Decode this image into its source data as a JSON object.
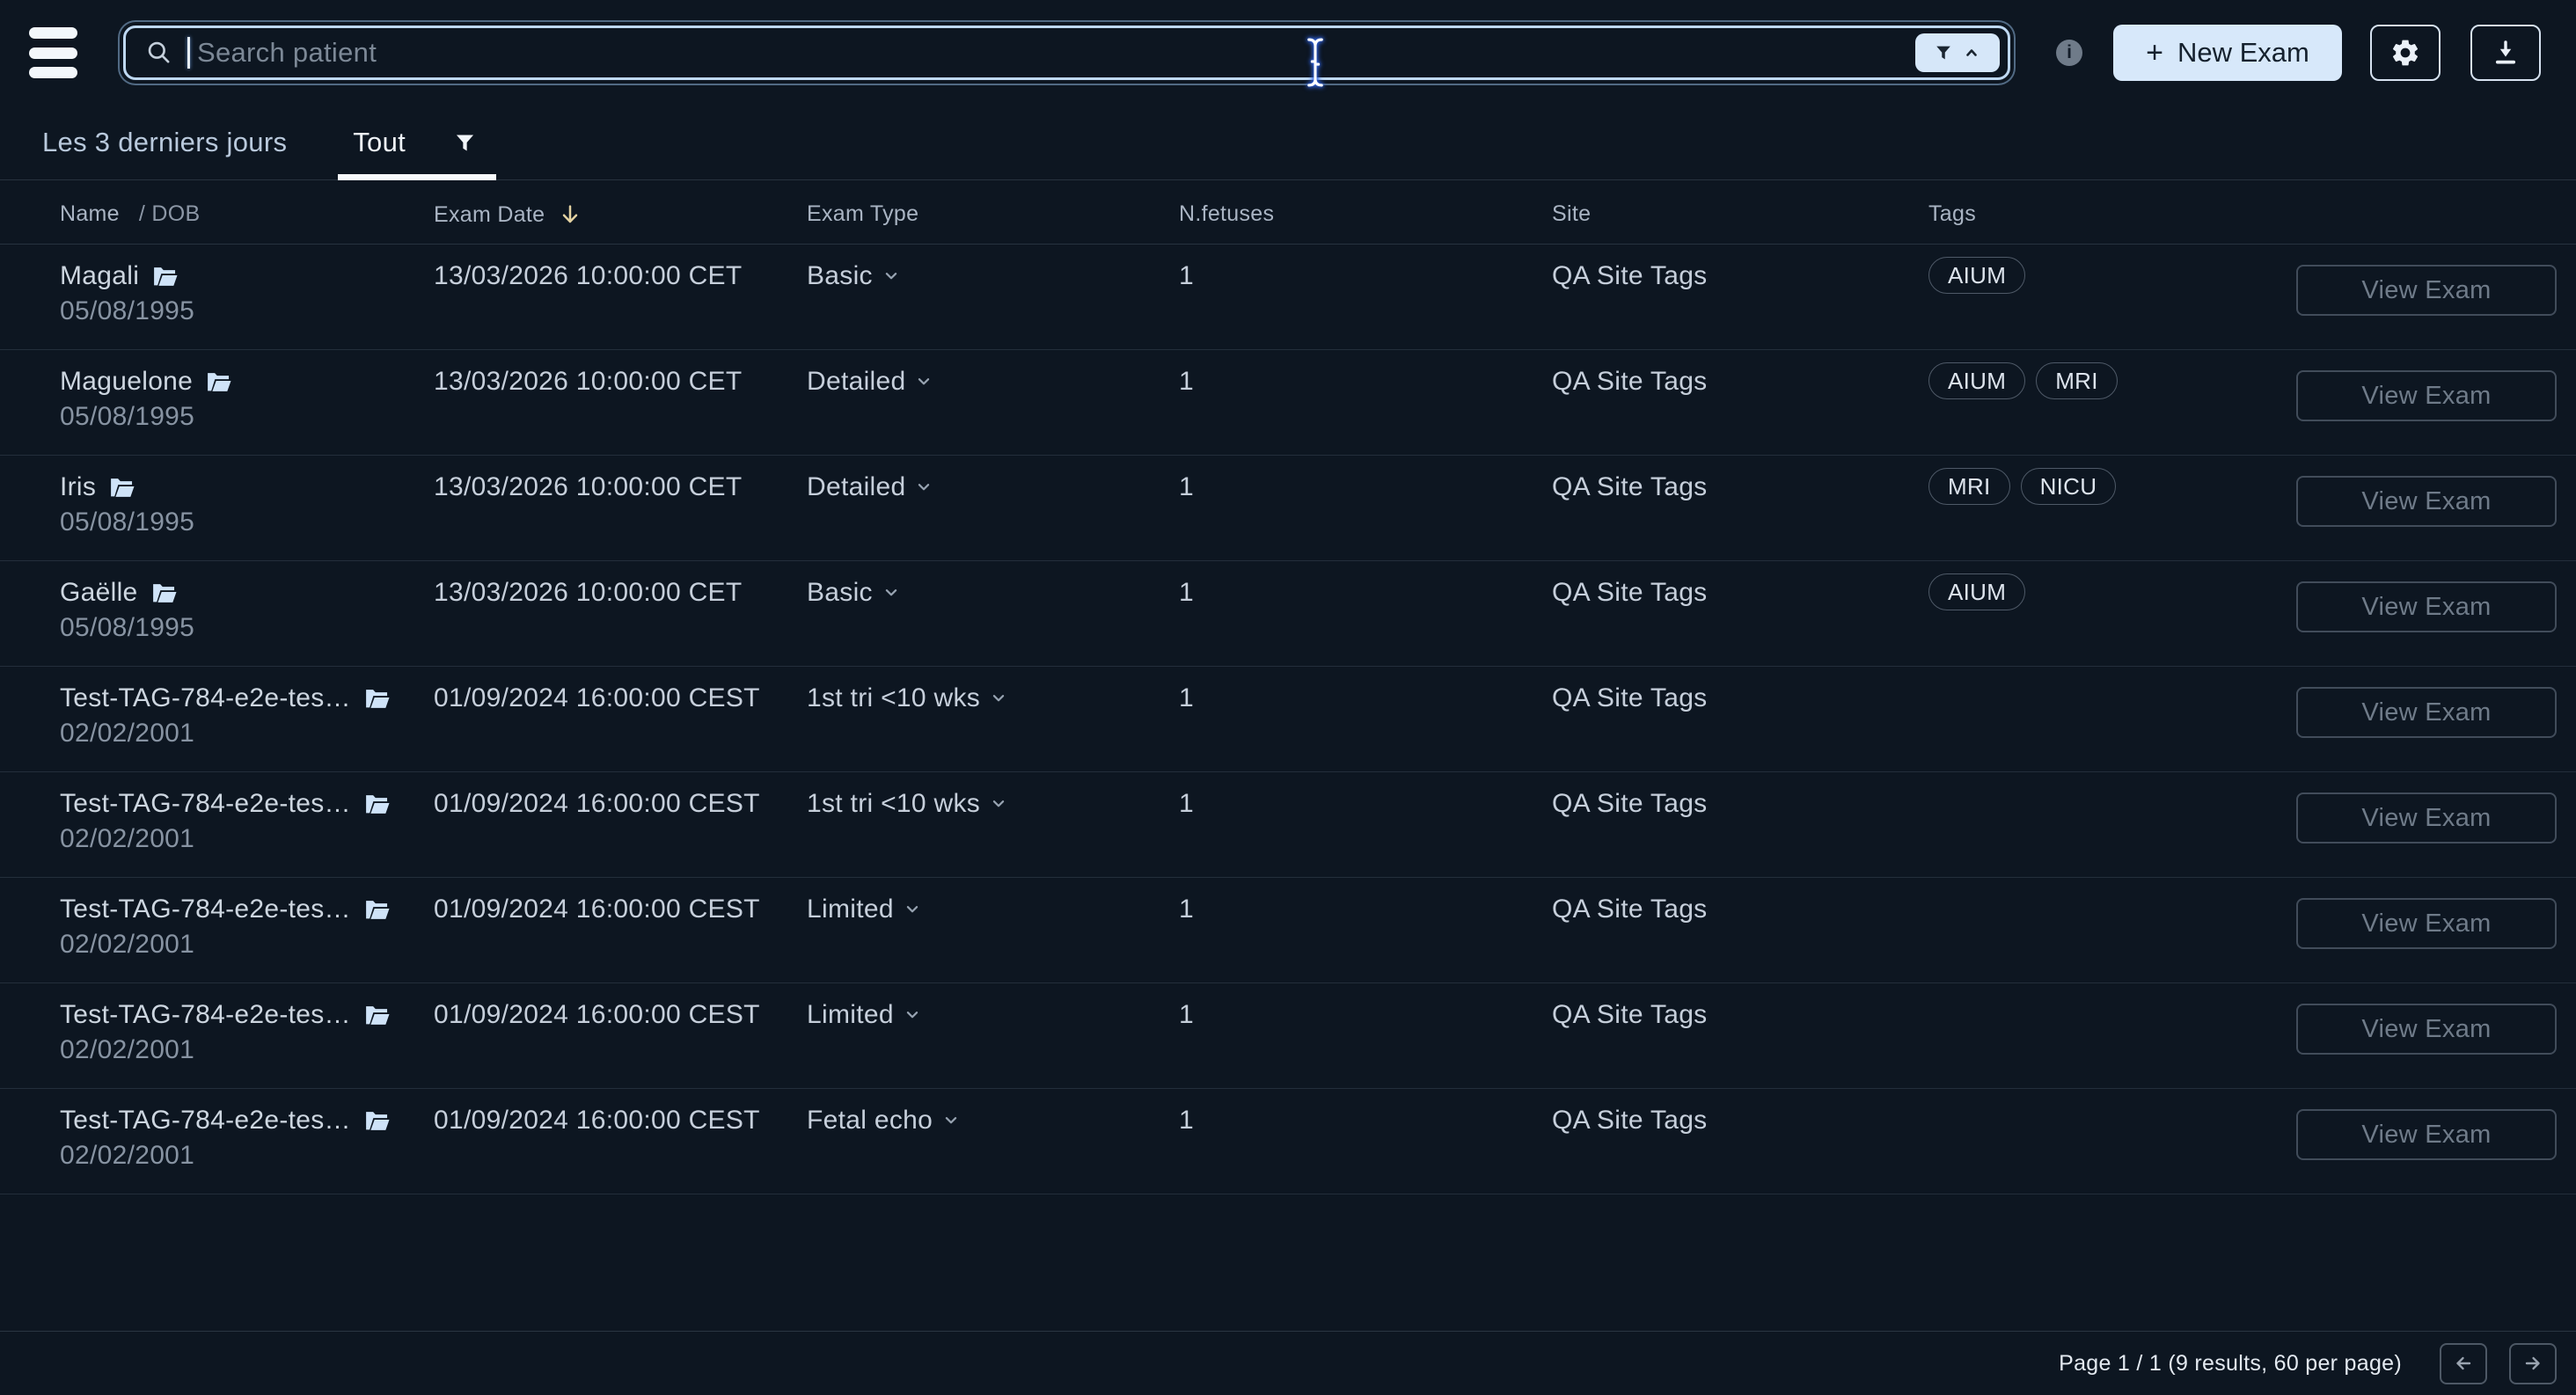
{
  "topbar": {
    "search_placeholder": "Search patient",
    "new_exam": {
      "plus": "+",
      "label": "New Exam"
    }
  },
  "filters": {
    "date_range_label": "Les 3 derniers jours",
    "active_tab": "Tout"
  },
  "table": {
    "headers": {
      "name": "Name",
      "dob": "/ DOB",
      "exam_date": "Exam Date",
      "exam_type": "Exam Type",
      "n_fetuses": "N.fetuses",
      "site": "Site",
      "tags": "Tags"
    },
    "view_exam_label": "View Exam",
    "rows": [
      {
        "name": "Magali",
        "dob": "05/08/1995",
        "exam_date": "13/03/2026 10:00:00 CET",
        "exam_type": "Basic",
        "n_fetuses": "1",
        "site": "QA Site Tags",
        "tags": [
          "AIUM"
        ]
      },
      {
        "name": "Maguelone",
        "dob": "05/08/1995",
        "exam_date": "13/03/2026 10:00:00 CET",
        "exam_type": "Detailed",
        "n_fetuses": "1",
        "site": "QA Site Tags",
        "tags": [
          "AIUM",
          "MRI"
        ]
      },
      {
        "name": "Iris",
        "dob": "05/08/1995",
        "exam_date": "13/03/2026 10:00:00 CET",
        "exam_type": "Detailed",
        "n_fetuses": "1",
        "site": "QA Site Tags",
        "tags": [
          "MRI",
          "NICU"
        ]
      },
      {
        "name": "Gaëlle",
        "dob": "05/08/1995",
        "exam_date": "13/03/2026 10:00:00 CET",
        "exam_type": "Basic",
        "n_fetuses": "1",
        "site": "QA Site Tags",
        "tags": [
          "AIUM"
        ]
      },
      {
        "name": "Test-TAG-784-e2e-tes…",
        "dob": "02/02/2001",
        "exam_date": "01/09/2024 16:00:00 CEST",
        "exam_type": "1st tri <10 wks",
        "n_fetuses": "1",
        "site": "QA Site Tags",
        "tags": []
      },
      {
        "name": "Test-TAG-784-e2e-tes…",
        "dob": "02/02/2001",
        "exam_date": "01/09/2024 16:00:00 CEST",
        "exam_type": "1st tri <10 wks",
        "n_fetuses": "1",
        "site": "QA Site Tags",
        "tags": []
      },
      {
        "name": "Test-TAG-784-e2e-tes…",
        "dob": "02/02/2001",
        "exam_date": "01/09/2024 16:00:00 CEST",
        "exam_type": "Limited",
        "n_fetuses": "1",
        "site": "QA Site Tags",
        "tags": []
      },
      {
        "name": "Test-TAG-784-e2e-tes…",
        "dob": "02/02/2001",
        "exam_date": "01/09/2024 16:00:00 CEST",
        "exam_type": "Limited",
        "n_fetuses": "1",
        "site": "QA Site Tags",
        "tags": []
      },
      {
        "name": "Test-TAG-784-e2e-tes…",
        "dob": "02/02/2001",
        "exam_date": "01/09/2024 16:00:00 CEST",
        "exam_type": "Fetal echo",
        "n_fetuses": "1",
        "site": "QA Site Tags",
        "tags": []
      }
    ]
  },
  "pagination": {
    "summary": "Page 1 / 1 (9 results, 60 per page)"
  },
  "colors": {
    "background": "#0d1621",
    "accent_light": "#d6e7f9",
    "tab_indicator": "#f7fafd",
    "sort_arrow": "#e3d2a2",
    "folder_icon": "#cfe3f8"
  }
}
